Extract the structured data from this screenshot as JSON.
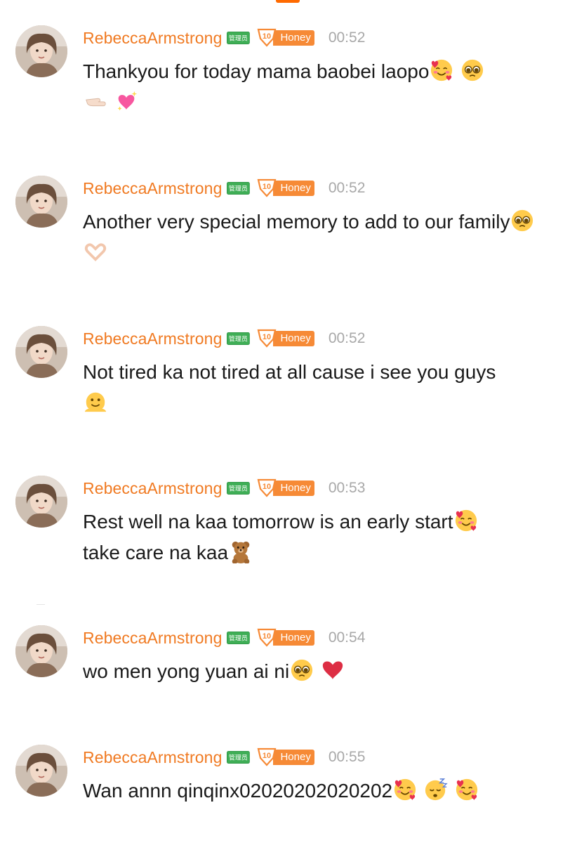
{
  "messages": [
    {
      "username": "RebeccaArmstrong",
      "admin_badge": "管理员",
      "fan_level": "10",
      "fan_label": "Honey",
      "time": "00:52",
      "text_parts": [
        "Thankyou for today mama baobei laopo"
      ],
      "emojis": [
        "smiling-face-with-hearts",
        "pleading-face",
        "pointing-hand",
        "sparkling-heart"
      ]
    },
    {
      "username": "RebeccaArmstrong",
      "admin_badge": "管理员",
      "fan_level": "10",
      "fan_label": "Honey",
      "time": "00:52",
      "text_parts": [
        "Another very special memory to add to our family"
      ],
      "emojis": [
        "pleading-face",
        "heart-hands"
      ]
    },
    {
      "username": "RebeccaArmstrong",
      "admin_badge": "管理员",
      "fan_level": "10",
      "fan_label": "Honey",
      "time": "00:52",
      "text_parts": [
        "Not tired ka not tired at all cause i see you guys"
      ],
      "emojis": [
        "melting-face"
      ]
    },
    {
      "username": "RebeccaArmstrong",
      "admin_badge": "管理员",
      "fan_level": "10",
      "fan_label": "Honey",
      "time": "00:53",
      "text_parts": [
        "Rest well na kaa tomorrow is an early start",
        "take care na kaa"
      ],
      "emojis": [
        "smiling-face-with-hearts",
        "teddy-bear"
      ]
    },
    {
      "username": "RebeccaArmstrong",
      "admin_badge": "管理员",
      "fan_level": "10",
      "fan_label": "Honey",
      "time": "00:54",
      "text_parts": [
        "wo men yong yuan ai ni"
      ],
      "emojis": [
        "pleading-face",
        "red-heart"
      ]
    },
    {
      "username": "RebeccaArmstrong",
      "admin_badge": "管理员",
      "fan_level": "10",
      "fan_label": "Honey",
      "time": "00:55",
      "text_parts": [
        "Wan annn qinqinx02020202020202"
      ],
      "emojis": [
        "smiling-face-with-hearts",
        "sleeping-face",
        "smiling-face-with-hearts"
      ]
    }
  ],
  "colors": {
    "username": "#f07a22",
    "admin_badge": "#3fae56",
    "fan_badge": "#f68a36",
    "time": "#a8a8a8",
    "text": "#1a1a1a"
  }
}
